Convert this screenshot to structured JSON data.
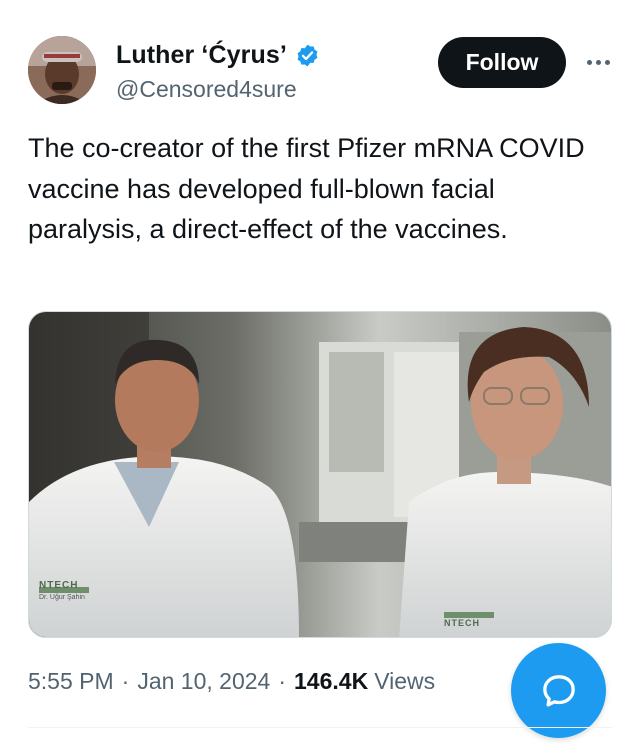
{
  "author": {
    "display_name": "Luther ‘Ćyrus’",
    "handle": "@Censored4sure",
    "avatar_icon": "user-avatar-photo",
    "verified": true,
    "verified_color": "#1d9bf0"
  },
  "actions": {
    "follow_label": "Follow",
    "more_icon": "more-horizontal-icon",
    "compose_icon": "reply-bubble-icon"
  },
  "tweet": {
    "text": "The co-creator of the first Pfizer mRNA COVID vaccine has developed full-blown facial paralysis, a direct-effect of the vaccines.",
    "media": {
      "type": "photo",
      "badge_left_logo": "NTECH",
      "badge_left_name": "Dr. Uğur Şahin",
      "badge_right_logo": "NTECH"
    }
  },
  "meta": {
    "time": "5:55 PM",
    "separator": "·",
    "date": "Jan 10, 2024",
    "views_count": "146.4K",
    "views_label": "Views"
  },
  "colors": {
    "text_primary": "#0f1419",
    "text_secondary": "#536471",
    "accent": "#1d9bf0",
    "follow_bg": "#0f1419"
  }
}
